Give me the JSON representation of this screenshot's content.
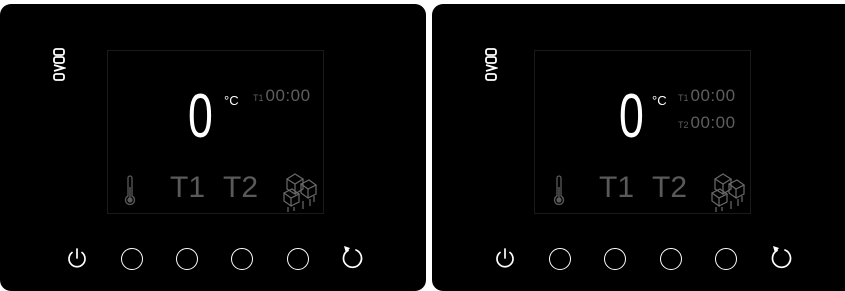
{
  "brand": {
    "logo_text": "EVCO"
  },
  "panels": [
    {
      "temperature": "0",
      "unit": "°C",
      "timers": [
        {
          "tag": "T1",
          "value": "00:00"
        }
      ],
      "labels": {
        "t1": "T1",
        "t2": "T2"
      },
      "icons": [
        "thermometer-icon",
        "ice-cubes-icon"
      ],
      "buttons": [
        "power-icon",
        "blank",
        "blank",
        "blank",
        "blank",
        "refresh-icon"
      ]
    },
    {
      "temperature": "0",
      "unit": "°C",
      "timers": [
        {
          "tag": "T1",
          "value": "00:00"
        },
        {
          "tag": "T2",
          "value": "00:00"
        }
      ],
      "labels": {
        "t1": "T1",
        "t2": "T2"
      },
      "icons": [
        "thermometer-icon",
        "ice-cubes-icon"
      ],
      "buttons": [
        "power-icon",
        "blank",
        "blank",
        "blank",
        "blank",
        "refresh-icon"
      ]
    }
  ],
  "colors": {
    "bezel": "#000000",
    "active_text": "#ffffff",
    "dim_text": "#5a5a5a"
  }
}
